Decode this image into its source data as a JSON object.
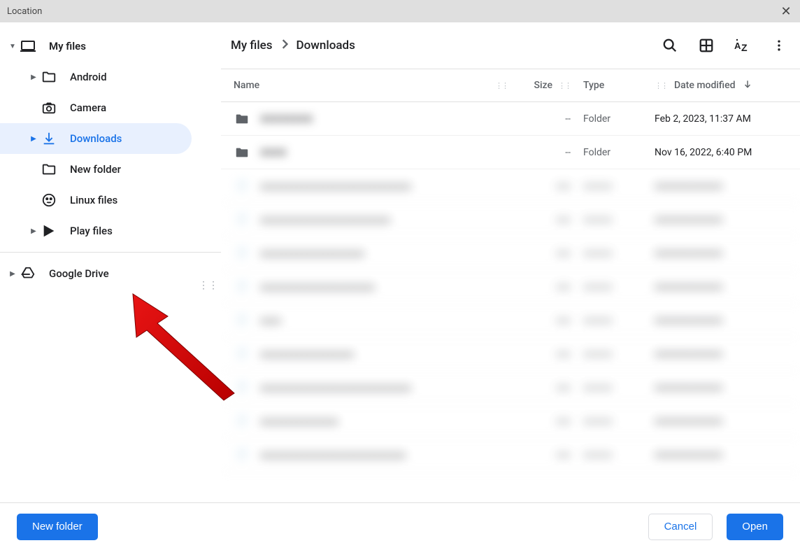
{
  "window": {
    "title": "Location"
  },
  "sidebar": {
    "root": {
      "label": "My files"
    },
    "items": [
      {
        "label": "Android",
        "icon": "folder",
        "caret": true
      },
      {
        "label": "Camera",
        "icon": "camera",
        "caret": false
      },
      {
        "label": "Downloads",
        "icon": "download",
        "caret": true,
        "selected": true
      },
      {
        "label": "New folder",
        "icon": "folder",
        "caret": false
      },
      {
        "label": "Linux files",
        "icon": "linux",
        "caret": false
      },
      {
        "label": "Play files",
        "icon": "play",
        "caret": true
      }
    ],
    "drive": {
      "label": "Google Drive"
    }
  },
  "breadcrumb": {
    "items": [
      "My files",
      "Downloads"
    ]
  },
  "columns": {
    "name": "Name",
    "size": "Size",
    "type": "Type",
    "date": "Date modified"
  },
  "files": [
    {
      "name": "XXXXXXXX",
      "size": "--",
      "type": "Folder",
      "date": "Feb 2, 2023, 11:37 AM",
      "icon": "folder"
    },
    {
      "name": "XXXX",
      "size": "--",
      "type": "Folder",
      "date": "Nov 16, 2022, 6:40 PM",
      "icon": "folder"
    }
  ],
  "footer": {
    "new_folder": "New folder",
    "cancel": "Cancel",
    "open": "Open"
  }
}
